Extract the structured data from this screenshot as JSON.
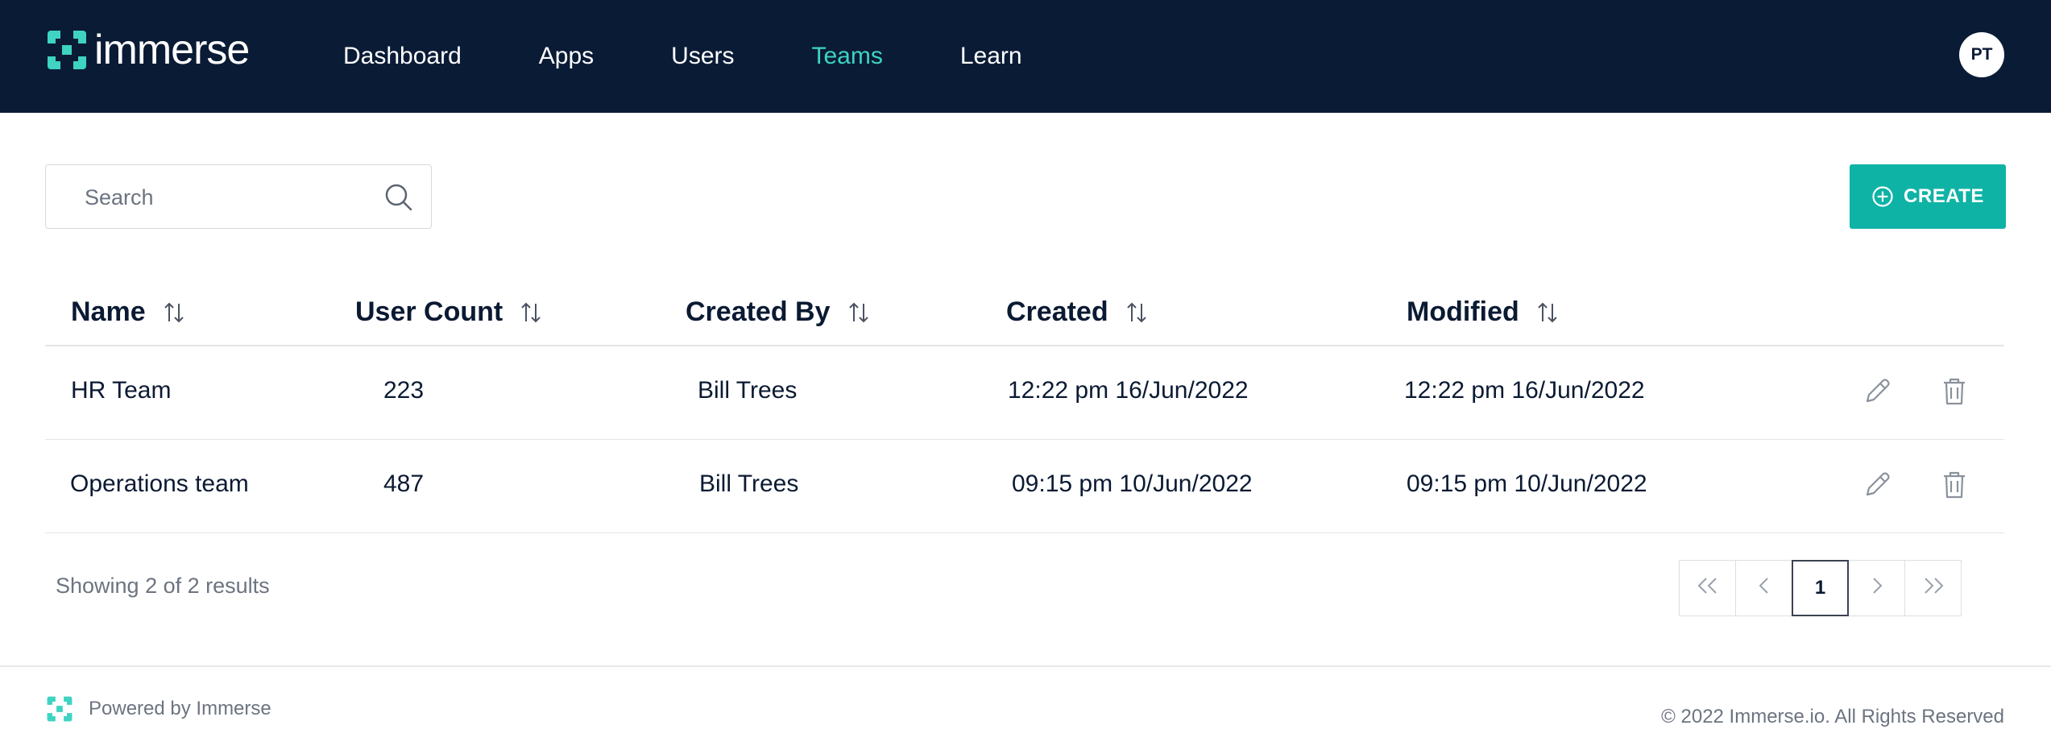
{
  "brand": {
    "name": "Immerse",
    "logo_text": "immerse",
    "accent": "#3ed3c2",
    "header_bg": "#0a1b36",
    "button_color": "#0fb3a6"
  },
  "nav": {
    "items": [
      {
        "label": "Dashboard",
        "active": false
      },
      {
        "label": "Apps",
        "active": false
      },
      {
        "label": "Users",
        "active": false
      },
      {
        "label": "Teams",
        "active": true
      },
      {
        "label": "Learn",
        "active": false
      }
    ]
  },
  "user": {
    "initials": "PT"
  },
  "search": {
    "placeholder": "Search",
    "value": "",
    "icon": "search-icon"
  },
  "toolbar": {
    "create_label": "CREATE",
    "create_icon": "plus-circle-icon"
  },
  "table": {
    "columns": [
      {
        "label": "Name"
      },
      {
        "label": "User Count"
      },
      {
        "label": "Created By"
      },
      {
        "label": "Created"
      },
      {
        "label": "Modified"
      }
    ],
    "rows": [
      {
        "name": "HR Team",
        "user_count": "223",
        "created_by": "Bill Trees",
        "created": "12:22 pm 16/Jun/2022",
        "modified": "12:22 pm 16/Jun/2022"
      },
      {
        "name": "Operations team",
        "user_count": "487",
        "created_by": "Bill Trees",
        "created": "09:15 pm 10/Jun/2022",
        "modified": "09:15 pm 10/Jun/2022"
      }
    ],
    "row_actions": [
      "pencil-icon",
      "trash-icon"
    ]
  },
  "pagination": {
    "summary": "Showing 2 of 2 results",
    "current_page": "1"
  },
  "footer": {
    "powered_by": "Powered by Immerse",
    "copyright": "© 2022 Immerse.io. All Rights Reserved"
  }
}
